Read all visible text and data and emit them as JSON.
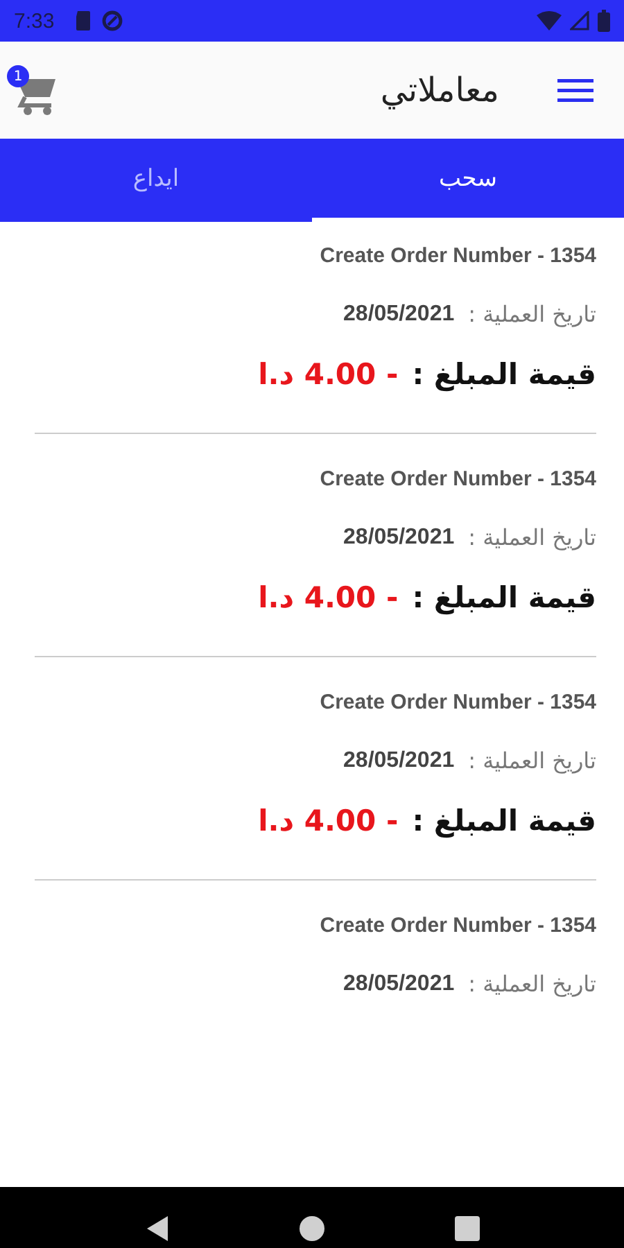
{
  "status_bar": {
    "time": "7:33"
  },
  "app_bar": {
    "title": "معاملاتي",
    "cart_count": "1"
  },
  "tabs": [
    {
      "label": "سحب",
      "selected": true
    },
    {
      "label": "ايداع",
      "selected": false
    }
  ],
  "transactions": [
    {
      "order": "Create Order Number - 1354",
      "date_label": "تاريخ العملية :",
      "date": "28/05/2021",
      "amount_label": "قيمة المبلغ :",
      "amount": "- 4.00 د.ا"
    },
    {
      "order": "Create Order Number - 1354",
      "date_label": "تاريخ العملية :",
      "date": "28/05/2021",
      "amount_label": "قيمة المبلغ :",
      "amount": "- 4.00 د.ا"
    },
    {
      "order": "Create Order Number - 1354",
      "date_label": "تاريخ العملية :",
      "date": "28/05/2021",
      "amount_label": "قيمة المبلغ :",
      "amount": "- 4.00 د.ا"
    },
    {
      "order": "Create Order Number - 1354",
      "date_label": "تاريخ العملية :",
      "date": "28/05/2021"
    }
  ]
}
